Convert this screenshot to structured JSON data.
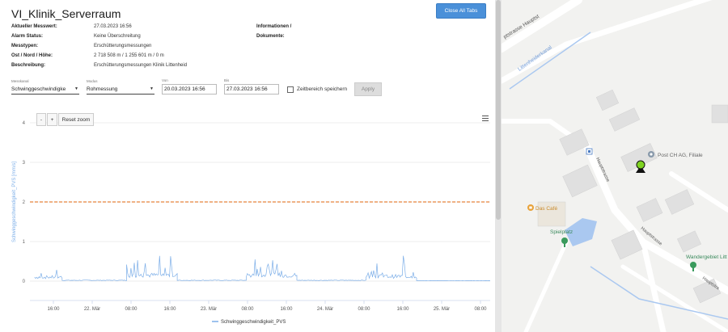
{
  "header": {
    "title": "VI_Klinik_Serverraum",
    "close_all_label": "Close All Tabs"
  },
  "info": {
    "labels": [
      "Aktueller Messwert:",
      "Alarm Status:",
      "Messtypen:",
      "Ost / Nord / Höhe:",
      "Beschreibung:"
    ],
    "values": [
      "27.03.2023 16:56",
      "Keine Überschreitung",
      "Erschütterungsmessungen",
      "2 718 508 m / 1 255 601 m / 0 m",
      "Erschütterungsmessungen Klinik Littenheid"
    ],
    "right_labels": [
      "Informationen /",
      "Dokumente:"
    ]
  },
  "controls": {
    "messkanal_label": "Messkanal",
    "messkanal_value": "Schwinggeschwindigke",
    "modus_label": "Modus",
    "modus_value": "Rohmessung",
    "von_label": "Von",
    "von_value": "20.03.2023 16:56",
    "bis_label": "Bis",
    "bis_value": "27.03.2023 16:56",
    "save_range_label": "Zeitbereich speichern",
    "apply_label": "Apply",
    "zoom_minus": "-",
    "zoom_plus": "+",
    "reset_zoom": "Reset zoom"
  },
  "chart_data": {
    "type": "line",
    "ylabel": "Schwinggeschwindigkeit_PVS [mm/s]",
    "ylim": [
      0,
      4
    ],
    "yticks": [
      0,
      1,
      2,
      3,
      4
    ],
    "xticks": [
      "16:00",
      "22. Mär",
      "08:00",
      "16:00",
      "23. Mär",
      "08:00",
      "16:00",
      "24. Mär",
      "08:00",
      "16:00",
      "25. Mär",
      "08:00"
    ],
    "threshold": 2,
    "threshold_color": "#e8843c",
    "series": [
      {
        "name": "Schwinggeschwindigkeit_PVS",
        "color": "#7caee8",
        "segments": [
          {
            "start": 0.01,
            "end": 0.07,
            "base": 0.1,
            "peak": 0.3
          },
          {
            "start": 0.07,
            "end": 0.21,
            "base": 0.02,
            "peak": 0.04
          },
          {
            "start": 0.21,
            "end": 0.32,
            "base": 0.15,
            "peak": 0.65
          },
          {
            "start": 0.32,
            "end": 0.47,
            "base": 0.02,
            "peak": 0.04
          },
          {
            "start": 0.47,
            "end": 0.58,
            "base": 0.15,
            "peak": 0.6
          },
          {
            "start": 0.58,
            "end": 0.73,
            "base": 0.02,
            "peak": 0.04
          },
          {
            "start": 0.73,
            "end": 0.84,
            "base": 0.12,
            "peak": 0.78
          },
          {
            "start": 0.84,
            "end": 1.0,
            "base": 0.01,
            "peak": 0.02
          }
        ]
      }
    ],
    "legend": "bottom-center"
  },
  "map": {
    "labels": {
      "street_top": "ptstrasse Hauptst",
      "canal": "Littenheiderkanal",
      "post": "Post CH AG, Filiale",
      "cafe": "Das Café",
      "playground": "Spielplatz",
      "hauptstrasse_1": "Hauptstrasse",
      "hauptstrasse_2": "Hauptstrasse",
      "hauptstrasse_3": "Hauptstra",
      "hiking": "Wandergebiet Litt"
    },
    "colors": {
      "water": "#aac8f0",
      "marker": "#7ed321",
      "poi_orange": "#e8a23a",
      "poi_green": "#3a9a5c",
      "post_icon": "#8899aa"
    }
  }
}
